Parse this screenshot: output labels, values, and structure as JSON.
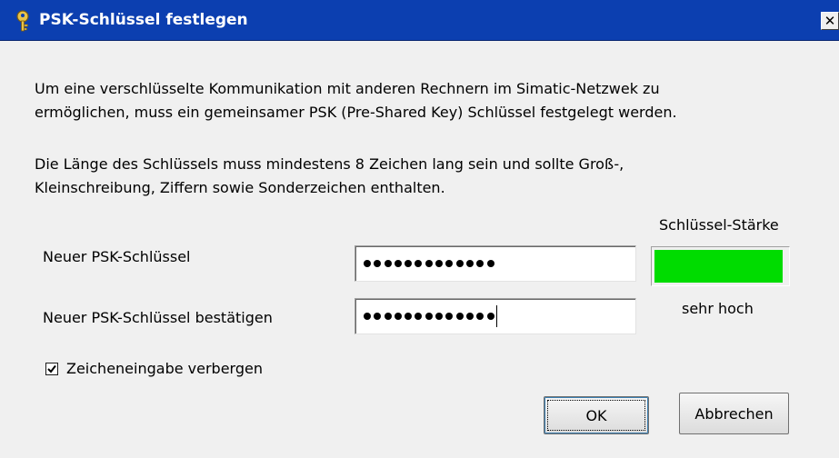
{
  "window": {
    "title": "PSK-Schlüssel festlegen",
    "close_glyph": "✕"
  },
  "intro": {
    "line1": "Um eine  verschlüsselte Kommunikation mit anderen Rechnern im Simatic-Netzwek zu",
    "line2": "ermöglichen, muss ein gemeinsamer PSK (Pre-Shared Key) Schlüssel festgelegt werden."
  },
  "rules": {
    "line1": "Die Länge des Schlüssels muss mindestens 8 Zeichen lang sein und sollte Groß-,",
    "line2": "Kleinschreibung, Ziffern sowie Sonderzeichen enthalten."
  },
  "fields": {
    "new_label": "Neuer PSK-Schlüssel",
    "new_masked_length": 13,
    "confirm_label": "Neuer PSK-Schlüssel bestätigen",
    "confirm_masked_length": 13
  },
  "strength": {
    "label": "Schlüssel-Stärke",
    "value": "sehr hoch",
    "level": 0.97,
    "color": "#00dc00"
  },
  "options": {
    "hide_input_label": "Zeicheneingabe verbergen",
    "hide_input_checked": true
  },
  "buttons": {
    "ok": "OK",
    "cancel": "Abbrechen"
  },
  "colors": {
    "titlebar": "#0c3fb0",
    "dialog_bg": "#f0f0f0"
  },
  "icons": {
    "title": "key-icon",
    "close": "close-icon",
    "check": "checkmark-icon"
  }
}
